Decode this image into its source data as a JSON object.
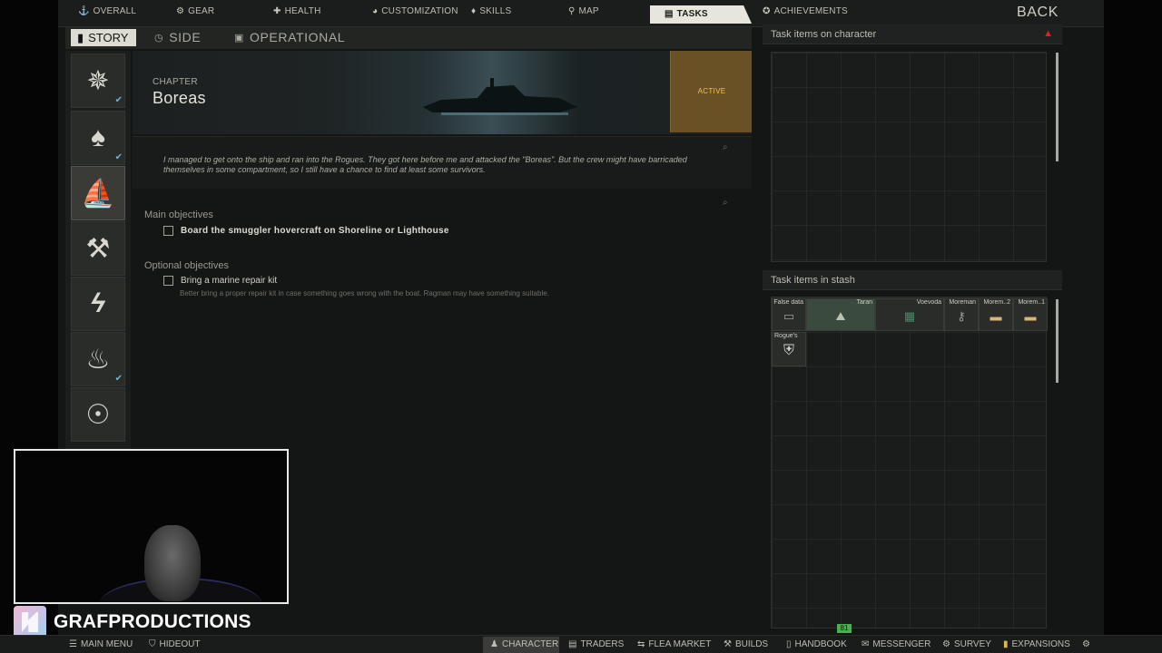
{
  "topnav": {
    "items": [
      {
        "label": "OVERALL",
        "icon": "anchor-icon"
      },
      {
        "label": "GEAR",
        "icon": "gear-icon"
      },
      {
        "label": "HEALTH",
        "icon": "health-icon"
      },
      {
        "label": "CUSTOMIZATION",
        "icon": "mask-icon"
      },
      {
        "label": "SKILLS",
        "icon": "skills-icon"
      },
      {
        "label": "MAP",
        "icon": "map-pin-icon"
      },
      {
        "label": "TASKS",
        "icon": "tasks-icon"
      },
      {
        "label": "ACHIEVEMENTS",
        "icon": "achievement-icon"
      }
    ],
    "back_label": "BACK"
  },
  "task_tabs": {
    "story": "STORY",
    "side": "SIDE",
    "operational": "OPERATIONAL"
  },
  "chapter": {
    "label": "CHAPTER",
    "title": "Boreas",
    "status": "ACTIVE",
    "description": "I managed to get onto the ship and ran into the Rogues. They got here before me and attacked the \"Boreas\". But the crew might have barricaded themselves in some compartment, so I still have a chance to find at least some survivors."
  },
  "objectives": {
    "main_heading": "Main objectives",
    "main": [
      "Board the smuggler hovercraft on Shoreline or Lighthouse"
    ],
    "optional_heading": "Optional objectives",
    "optional": [
      {
        "text": "Bring a marine repair kit",
        "hint": "Better bring a proper repair kit in case something goes wrong with the boat. Ragman may have something suitable."
      }
    ]
  },
  "right_panel": {
    "on_character_title": "Task items on character",
    "in_stash_title": "Task items in stash",
    "stash_items": [
      {
        "label": "False data"
      },
      {
        "label": "Taran"
      },
      {
        "label": "Voevoda"
      },
      {
        "label": "Moreman"
      },
      {
        "label": "Morem..2"
      },
      {
        "label": "Morem..1"
      },
      {
        "label": "Rogue's"
      }
    ]
  },
  "overlay": {
    "brand_name": "GRAFPRODUCTIONS"
  },
  "bottombar": {
    "left": [
      {
        "label": "MAIN MENU",
        "icon": "menu-icon"
      },
      {
        "label": "HIDEOUT",
        "icon": "hideout-icon"
      }
    ],
    "right": [
      {
        "label": "CHARACTER",
        "icon": "character-icon"
      },
      {
        "label": "TRADERS",
        "icon": "traders-icon"
      },
      {
        "label": "FLEA MARKET",
        "icon": "flea-market-icon"
      },
      {
        "label": "BUILDS",
        "icon": "builds-icon"
      },
      {
        "label": "HANDBOOK",
        "icon": "handbook-icon"
      },
      {
        "label": "MESSENGER",
        "icon": "messenger-icon"
      },
      {
        "label": "SURVEY",
        "icon": "survey-icon"
      },
      {
        "label": "EXPANSIONS",
        "icon": "expansions-icon"
      }
    ],
    "level_badge": "81"
  },
  "colors": {
    "active_status": "#f1c25a",
    "active_bg": "#6a5025",
    "accent_check": "#6fb4d6",
    "level_badge": "#46b34a",
    "warning": "#dd2222"
  }
}
